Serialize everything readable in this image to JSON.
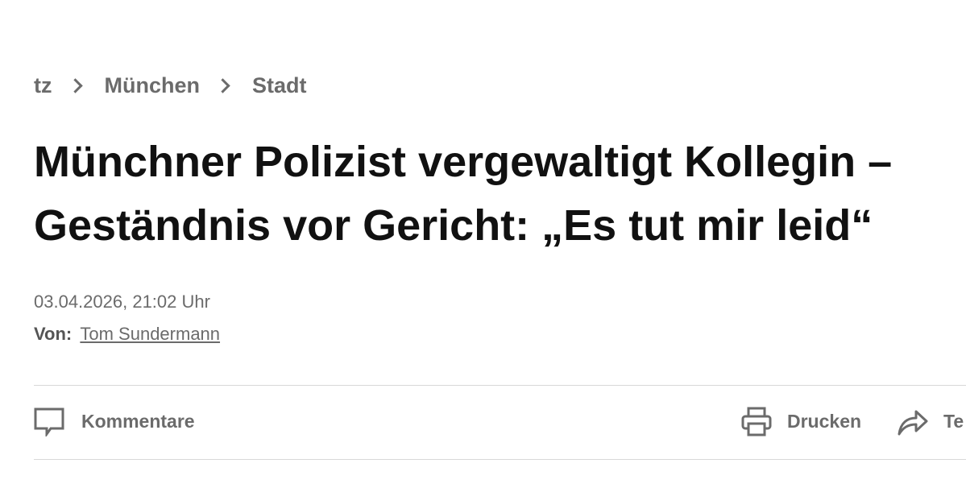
{
  "breadcrumb": {
    "items": [
      "tz",
      "München",
      "Stadt"
    ]
  },
  "article": {
    "headline_line1": "Münchner Polizist vergewaltigt Kollegin –",
    "headline_line2": "Geständnis vor Gericht: „Es tut mir leid“",
    "date": "03.04.2026, 21:02 Uhr",
    "byline_label": "Von:",
    "author": "Tom Sundermann"
  },
  "toolbar": {
    "comments_label": "Kommentare",
    "print_label": "Drucken",
    "share_label": "Te",
    "comments_icon": "speech-bubble-icon",
    "print_icon": "printer-icon",
    "share_icon": "share-arrow-icon"
  },
  "colors": {
    "text_dark": "#111111",
    "text_muted": "#6b6b6b",
    "divider": "#d8d8d8"
  }
}
